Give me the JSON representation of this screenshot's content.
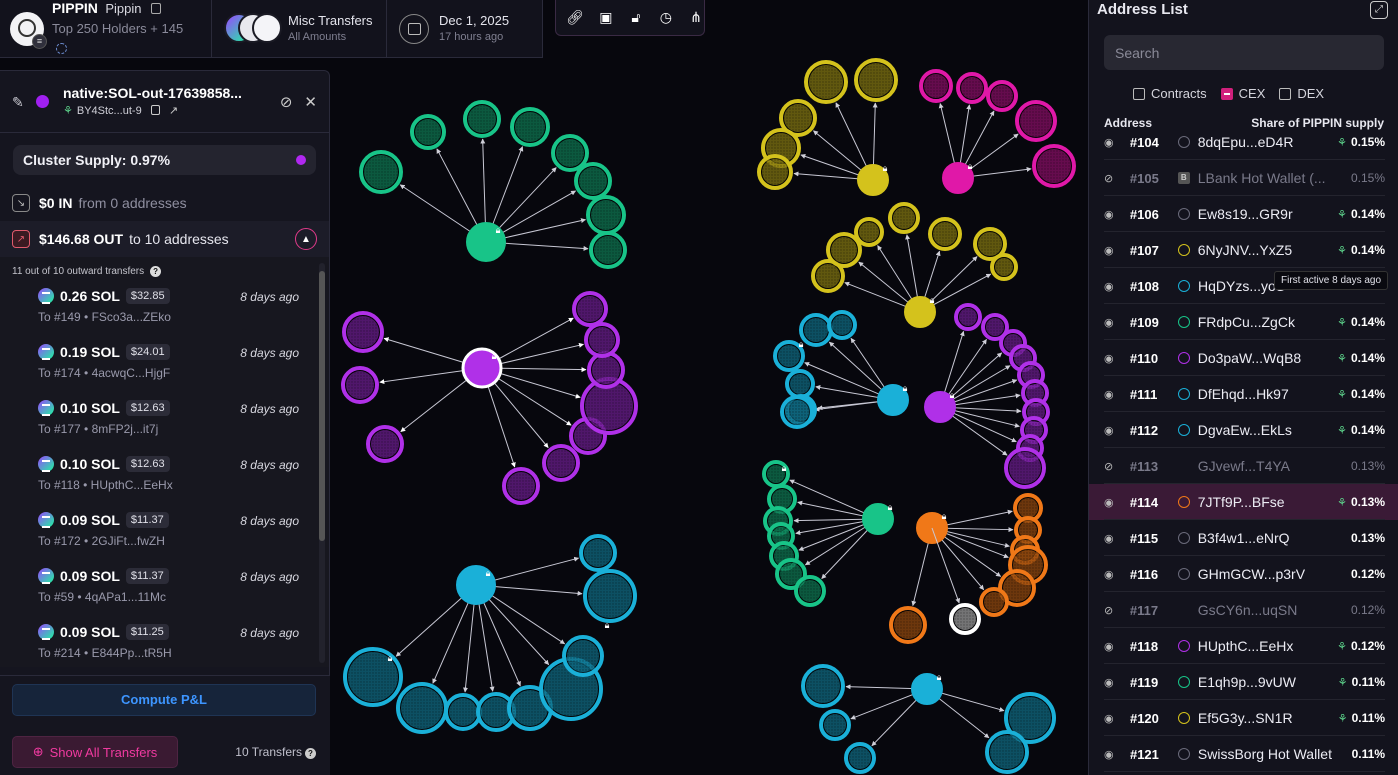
{
  "topbar": {
    "token_symbol": "PIPPIN",
    "token_name": "Pippin",
    "holders_label": "Top 250 Holders + 145",
    "filter_title": "Misc Transfers",
    "filter_sub": "All Amounts",
    "date": "Dec 1, 2025",
    "date_ago": "17 hours ago",
    "toolbar_icons": [
      "link-icon",
      "save-icon",
      "unlock-icon",
      "clock-icon",
      "share-icon"
    ]
  },
  "cluster_panel": {
    "title": "native:SOL-out-17639858...",
    "subtitle": "BY4Stc...ut-9",
    "cluster_supply": "Cluster Supply: 0.97%",
    "in_amount": "$0 IN",
    "in_desc": "from 0 addresses",
    "out_amount": "$146.68 OUT",
    "out_desc": "to 10 addresses",
    "transfers_summary": "11 out of 10 outward transfers",
    "transfers": [
      {
        "amount": "0.26 SOL",
        "usd": "$32.85",
        "time": "8 days ago",
        "to": "To #149 • FSco3a...ZEko"
      },
      {
        "amount": "0.19 SOL",
        "usd": "$24.01",
        "time": "8 days ago",
        "to": "To #174 • 4acwqC...HjgF"
      },
      {
        "amount": "0.10 SOL",
        "usd": "$12.63",
        "time": "8 days ago",
        "to": "To #177 • 8mFP2j...it7j"
      },
      {
        "amount": "0.10 SOL",
        "usd": "$12.63",
        "time": "8 days ago",
        "to": "To #118 • HUpthC...EeHx"
      },
      {
        "amount": "0.09 SOL",
        "usd": "$11.37",
        "time": "8 days ago",
        "to": "To #172 • 2GJiFt...fwZH"
      },
      {
        "amount": "0.09 SOL",
        "usd": "$11.37",
        "time": "8 days ago",
        "to": "To #59 • 4qAPa1...11Mc"
      },
      {
        "amount": "0.09 SOL",
        "usd": "$11.25",
        "time": "8 days ago",
        "to": "To #214 • E844Pp...tR5H"
      }
    ],
    "compute_pnl": "Compute P&L",
    "show_all": "Show All Transfers",
    "transfer_count": "10 Transfers"
  },
  "address_list": {
    "title": "Address List",
    "search_placeholder": "Search",
    "filters": [
      {
        "label": "Contracts",
        "checked": false
      },
      {
        "label": "CEX",
        "checked": true
      },
      {
        "label": "DEX",
        "checked": false
      }
    ],
    "col_address": "Address",
    "col_share": "Share of PIPPIN supply",
    "tooltip": "First active 8 days ago",
    "rows": [
      {
        "rank": "#104",
        "address": "8dqEpu...eD4R",
        "share": "0.15%",
        "ring": "#6a6a7a",
        "sprout": true,
        "hidden": false
      },
      {
        "rank": "#105",
        "address": "LBank Hot Wallet (...",
        "share": "0.15%",
        "ring": "exchange",
        "sprout": false,
        "hidden": true
      },
      {
        "rank": "#106",
        "address": "Ew8s19...GR9r",
        "share": "0.14%",
        "ring": "#6a6a7a",
        "sprout": true,
        "hidden": false
      },
      {
        "rank": "#107",
        "address": "6NyJNV...YxZ5",
        "share": "0.14%",
        "ring": "#d4c21c",
        "sprout": true,
        "hidden": false
      },
      {
        "rank": "#108",
        "address": "HqDYzs...yoS",
        "share": "",
        "ring": "#1ab0d8",
        "sprout": false,
        "hidden": false
      },
      {
        "rank": "#109",
        "address": "FRdpCu...ZgCk",
        "share": "0.14%",
        "ring": "#18c488",
        "sprout": true,
        "hidden": false
      },
      {
        "rank": "#110",
        "address": "Do3paW...WqB8",
        "share": "0.14%",
        "ring": "#b030e8",
        "sprout": true,
        "hidden": false
      },
      {
        "rank": "#111",
        "address": "DfEhqd...Hk97",
        "share": "0.14%",
        "ring": "#1ab0d8",
        "sprout": true,
        "hidden": false
      },
      {
        "rank": "#112",
        "address": "DgvaEw...EkLs",
        "share": "0.14%",
        "ring": "#1ab0d8",
        "sprout": true,
        "hidden": false
      },
      {
        "rank": "#113",
        "address": "GJvewf...T4YA",
        "share": "0.13%",
        "ring": "none",
        "sprout": false,
        "hidden": true
      },
      {
        "rank": "#114",
        "address": "7JTf9P...BFse",
        "share": "0.13%",
        "ring": "#f07818",
        "sprout": true,
        "hidden": false,
        "selected": true
      },
      {
        "rank": "#115",
        "address": "B3f4w1...eNrQ",
        "share": "0.13%",
        "ring": "#6a6a7a",
        "sprout": false,
        "hidden": false
      },
      {
        "rank": "#116",
        "address": "GHmGCW...p3rV",
        "share": "0.12%",
        "ring": "#6a6a7a",
        "sprout": false,
        "hidden": false
      },
      {
        "rank": "#117",
        "address": "GsCY6n...uqSN",
        "share": "0.12%",
        "ring": "none",
        "sprout": false,
        "hidden": true
      },
      {
        "rank": "#118",
        "address": "HUpthC...EeHx",
        "share": "0.12%",
        "ring": "#b030e8",
        "sprout": true,
        "hidden": false
      },
      {
        "rank": "#119",
        "address": "E1qh9p...9vUW",
        "share": "0.11%",
        "ring": "#18c488",
        "sprout": true,
        "hidden": false
      },
      {
        "rank": "#120",
        "address": "Ef5G3y...SN1R",
        "share": "0.11%",
        "ring": "#d4c21c",
        "sprout": true,
        "hidden": false
      },
      {
        "rank": "#121",
        "address": "SwissBorg Hot Wallet",
        "share": "0.11%",
        "ring": "#6a6a7a",
        "sprout": false,
        "hidden": false
      }
    ]
  },
  "colors": {
    "purple": "#b030e8",
    "green": "#18c488",
    "yellow": "#d4c21c",
    "magenta": "#e018a8",
    "cyan": "#1ab0d8",
    "orange": "#f07818",
    "accent_pink": "#e03a8a"
  }
}
